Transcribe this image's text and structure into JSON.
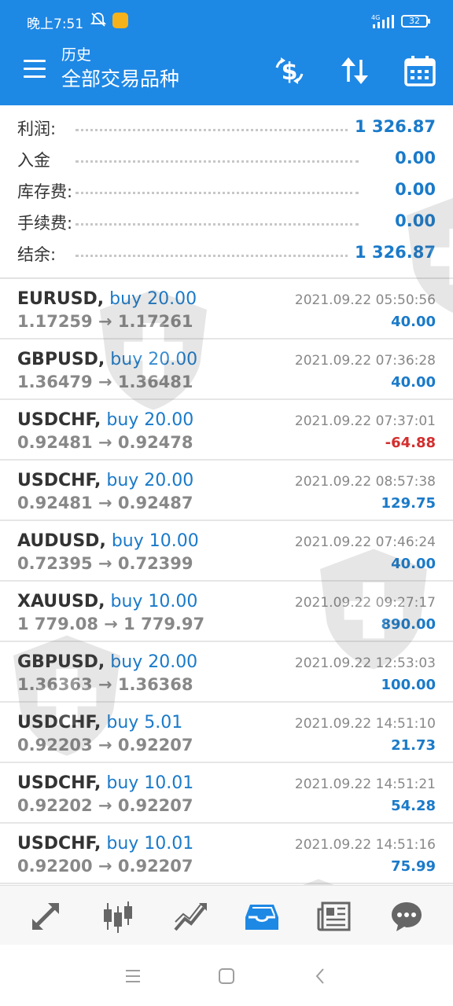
{
  "status_bar": {
    "time": "晚上7:51",
    "network": "4G",
    "battery": "32"
  },
  "header": {
    "subtitle": "历史",
    "title": "全部交易品种"
  },
  "summary": [
    {
      "label": "利润:",
      "value": "1 326.87"
    },
    {
      "label": "入金",
      "value": "0.00"
    },
    {
      "label": "库存费:",
      "value": "0.00"
    },
    {
      "label": "手续费:",
      "value": "0.00"
    },
    {
      "label": "结余:",
      "value": "1 326.87"
    }
  ],
  "trades": [
    {
      "symbol": "EURUSD,",
      "side": "buy 20.00",
      "prices": "1.17259 → 1.17261",
      "time": "2021.09.22 05:50:56",
      "profit": "40.00"
    },
    {
      "symbol": "GBPUSD,",
      "side": "buy 20.00",
      "prices": "1.36479 → 1.36481",
      "time": "2021.09.22 07:36:28",
      "profit": "40.00"
    },
    {
      "symbol": "USDCHF,",
      "side": "buy 20.00",
      "prices": "0.92481 → 0.92478",
      "time": "2021.09.22 07:37:01",
      "profit": "-64.88"
    },
    {
      "symbol": "USDCHF,",
      "side": "buy 20.00",
      "prices": "0.92481 → 0.92487",
      "time": "2021.09.22 08:57:38",
      "profit": "129.75"
    },
    {
      "symbol": "AUDUSD,",
      "side": "buy 10.00",
      "prices": "0.72395 → 0.72399",
      "time": "2021.09.22 07:46:24",
      "profit": "40.00"
    },
    {
      "symbol": "XAUUSD,",
      "side": "buy 10.00",
      "prices": "1 779.08 → 1 779.97",
      "time": "2021.09.22 09:27:17",
      "profit": "890.00"
    },
    {
      "symbol": "GBPUSD,",
      "side": "buy 20.00",
      "prices": "1.36363 → 1.36368",
      "time": "2021.09.22 12:53:03",
      "profit": "100.00"
    },
    {
      "symbol": "USDCHF,",
      "side": "buy 5.01",
      "prices": "0.92203 → 0.92207",
      "time": "2021.09.22 14:51:10",
      "profit": "21.73"
    },
    {
      "symbol": "USDCHF,",
      "side": "buy 10.01",
      "prices": "0.92202 → 0.92207",
      "time": "2021.09.22 14:51:21",
      "profit": "54.28"
    },
    {
      "symbol": "USDCHF,",
      "side": "buy 10.01",
      "prices": "0.92200 → 0.92207",
      "time": "2021.09.22 14:51:16",
      "profit": "75.99"
    }
  ],
  "colors": {
    "header": "#1e88e5",
    "accent": "#1a7ac9",
    "negative": "#d32f2f",
    "nav_active": "#1e88e5",
    "nav_inactive": "#666666"
  },
  "bottom_nav": [
    {
      "icon": "quotes-icon",
      "active": false
    },
    {
      "icon": "chart-icon",
      "active": false
    },
    {
      "icon": "trade-icon",
      "active": false
    },
    {
      "icon": "history-icon",
      "active": true
    },
    {
      "icon": "news-icon",
      "active": false
    },
    {
      "icon": "chat-icon",
      "active": false
    }
  ]
}
